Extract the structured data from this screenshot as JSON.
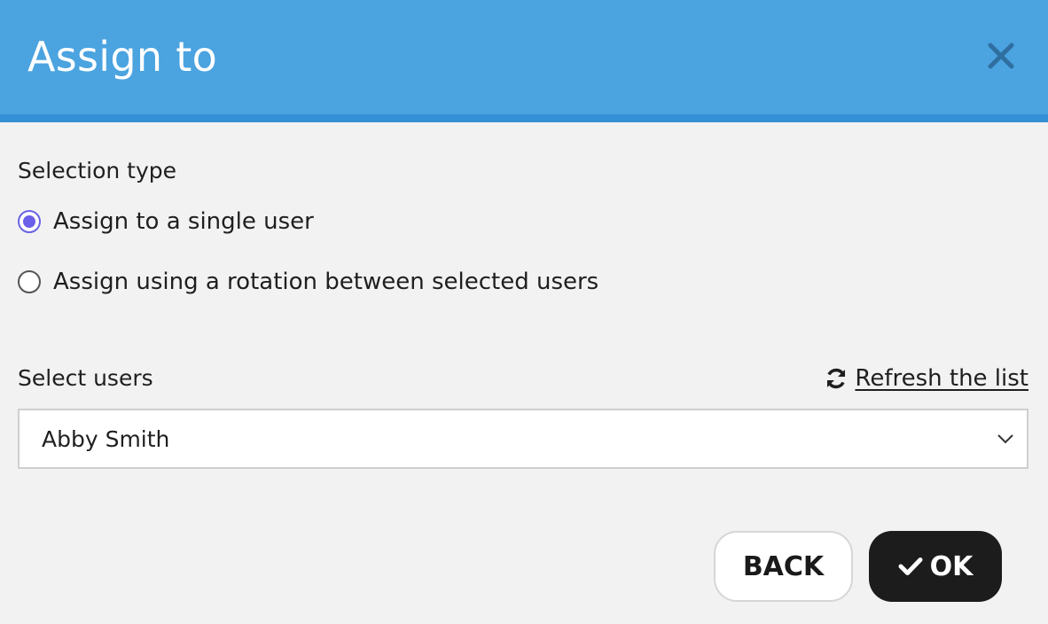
{
  "dialog": {
    "title": "Assign to",
    "close_icon": "close-icon"
  },
  "selection_type": {
    "label": "Selection type",
    "options": [
      {
        "label": "Assign to a single user",
        "checked": true
      },
      {
        "label": "Assign using a rotation between selected users",
        "checked": false
      }
    ]
  },
  "users": {
    "label": "Select users",
    "refresh_label": "Refresh the list",
    "refresh_icon": "refresh-icon",
    "selected": "Abby Smith"
  },
  "buttons": {
    "back_label": "BACK",
    "ok_label": "OK",
    "ok_icon": "check-icon"
  },
  "colors": {
    "header": "#4ba3e0",
    "header_border": "#3490d4",
    "radio_accent": "#6b60e8",
    "ok_button": "#1c1c1c"
  }
}
